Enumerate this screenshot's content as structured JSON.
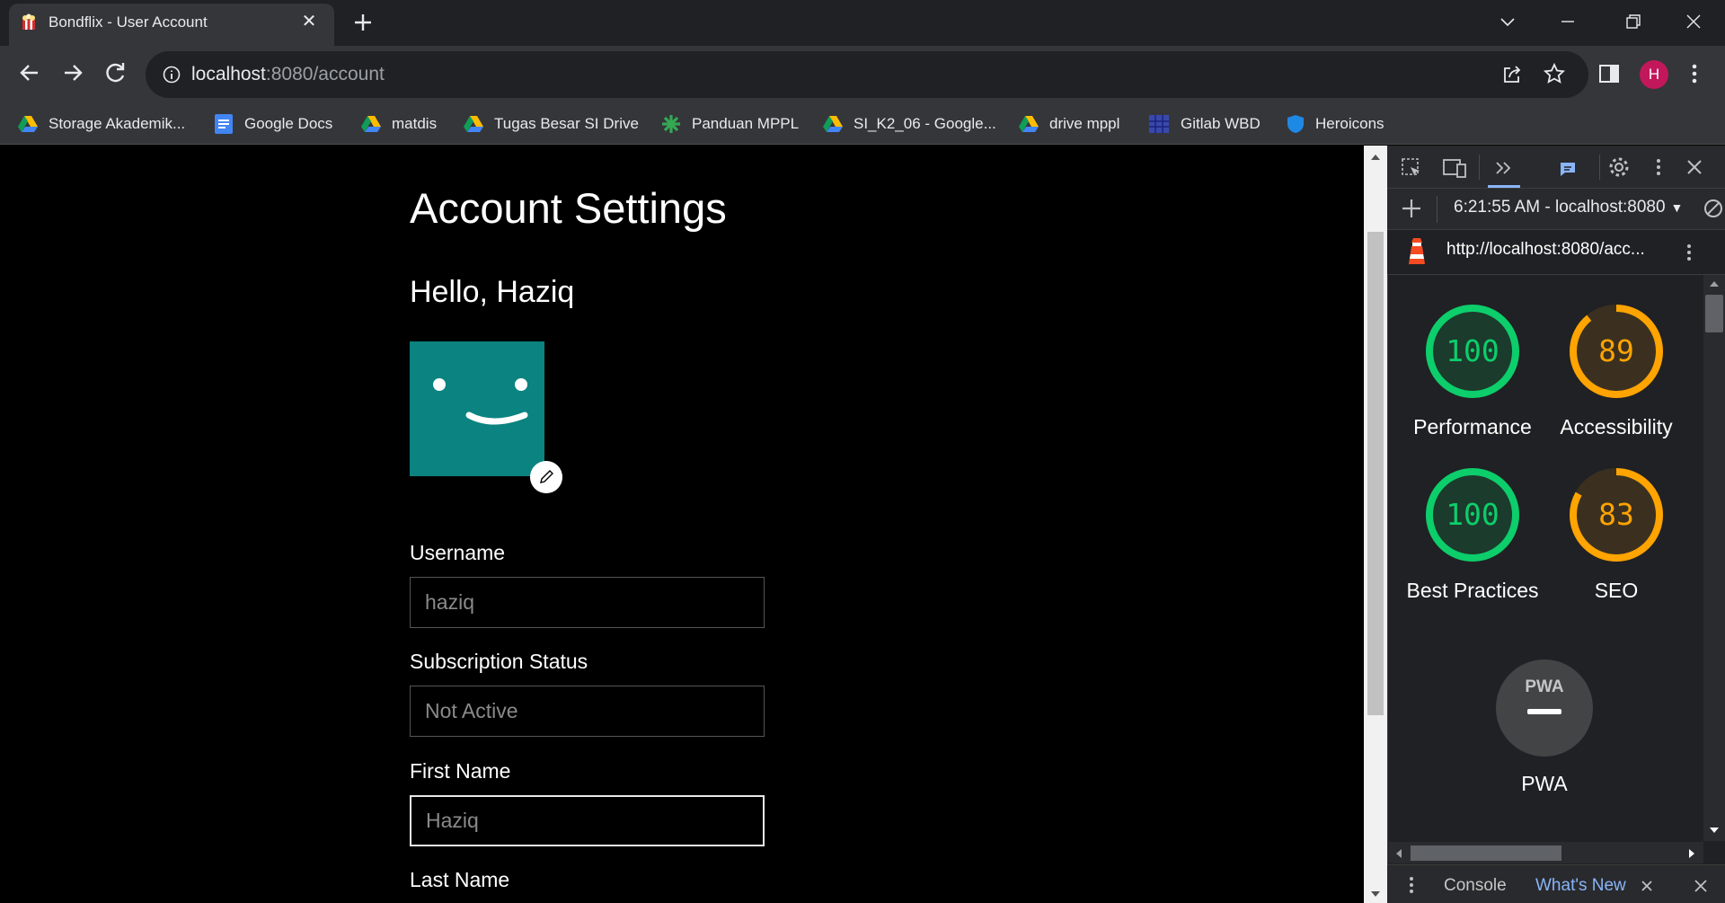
{
  "tab": {
    "title": "Bondflix - User Account"
  },
  "address_bar": {
    "host": "localhost",
    "path": ":8080/account"
  },
  "profile": {
    "initial": "H",
    "color": "#c2185b"
  },
  "bookmarks": [
    {
      "label": "Storage Akademik...",
      "icon": "google-drive-icon"
    },
    {
      "label": "Google Docs",
      "icon": "google-docs-icon"
    },
    {
      "label": "matdis",
      "icon": "google-drive-icon"
    },
    {
      "label": "Tugas Besar SI Drive",
      "icon": "google-drive-icon"
    },
    {
      "label": "Panduan MPPL",
      "icon": "green-asterisk-icon"
    },
    {
      "label": "SI_K2_06 - Google...",
      "icon": "google-drive-icon"
    },
    {
      "label": "drive mppl",
      "icon": "google-drive-icon"
    },
    {
      "label": "Gitlab WBD",
      "icon": "gitlab-icon"
    },
    {
      "label": "Heroicons",
      "icon": "shield-icon"
    }
  ],
  "page": {
    "title": "Account Settings",
    "greeting": "Hello, Haziq",
    "avatar_color": "#0b8380",
    "fields": [
      {
        "label": "Username",
        "value": "haziq"
      },
      {
        "label": "Subscription Status",
        "value": "Not Active"
      },
      {
        "label": "First Name",
        "value": "Haziq"
      },
      {
        "label": "Last Name",
        "value": ""
      }
    ]
  },
  "devtools": {
    "report_time": "6:21:55 AM - localhost:8080",
    "report_url": "http://localhost:8080/acc...",
    "scores": [
      {
        "name": "Performance",
        "score": "100",
        "value": 100,
        "status": "pass"
      },
      {
        "name": "Accessibility",
        "score": "89",
        "value": 89,
        "status": "average"
      },
      {
        "name": "Best Practices",
        "score": "100",
        "value": 100,
        "status": "pass"
      },
      {
        "name": "SEO",
        "score": "83",
        "value": 83,
        "status": "average"
      }
    ],
    "pwa": {
      "label": "PWA",
      "badge": "PWA"
    },
    "drawer": {
      "console": "Console",
      "whats_new": "What's New"
    },
    "colors": {
      "pass": "#0cce6b",
      "average": "#ffa400"
    }
  }
}
